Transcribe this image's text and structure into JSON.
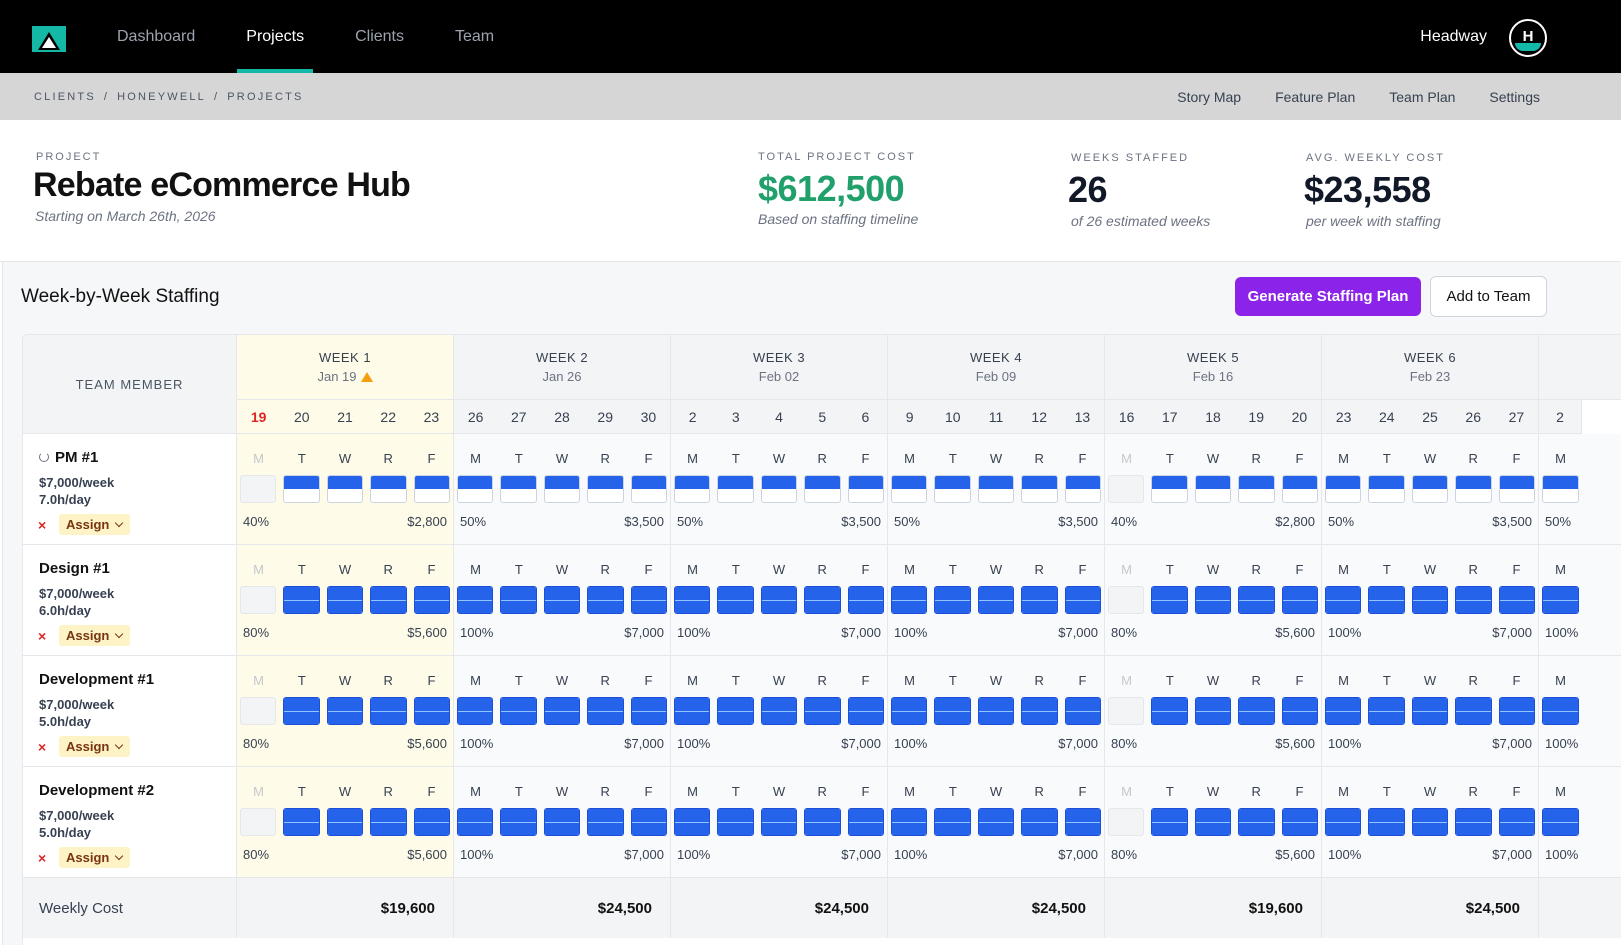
{
  "nav": {
    "tabs": [
      {
        "label": "Dashboard",
        "active": false
      },
      {
        "label": "Projects",
        "active": true
      },
      {
        "label": "Clients",
        "active": false
      },
      {
        "label": "Team",
        "active": false
      }
    ],
    "brand": "Headway",
    "avatar_letter": "H",
    "accent_color": "#14b8a6"
  },
  "breadcrumb": [
    "CLIENTS",
    "/",
    "HONEYWELL",
    "/",
    "PROJECTS"
  ],
  "sublinks": [
    "Story Map",
    "Feature Plan",
    "Team Plan",
    "Settings"
  ],
  "project": {
    "label": "PROJECT",
    "title": "Rebate eCommerce Hub",
    "start": "Starting on March 26th, 2026"
  },
  "stats": [
    {
      "label": "TOTAL PROJECT COST",
      "value": "$612,500",
      "note": "Based on staffing timeline",
      "color": "#22a06b"
    },
    {
      "label": "WEEKS STAFFED",
      "value": "26",
      "note": "of 26 estimated weeks",
      "color": "#111111"
    },
    {
      "label": "AVG. WEEKLY COST",
      "value": "$23,558",
      "note": "per week with staffing",
      "color": "#111111"
    }
  ],
  "staffing": {
    "title": "Week-by-Week Staffing",
    "generate_label": "Generate Staffing Plan",
    "add_label": "Add to Team",
    "member_header": "TEAM MEMBER",
    "weeks": [
      {
        "label": "WEEK 1",
        "date": "Jan 19",
        "warning": true,
        "current": true,
        "days": [
          "19",
          "20",
          "21",
          "22",
          "23"
        ],
        "today_index": 0
      },
      {
        "label": "WEEK 2",
        "date": "Jan 26",
        "warning": false,
        "current": false,
        "days": [
          "26",
          "27",
          "28",
          "29",
          "30"
        ]
      },
      {
        "label": "WEEK 3",
        "date": "Feb 02",
        "warning": false,
        "current": false,
        "days": [
          "2",
          "3",
          "4",
          "5",
          "6"
        ]
      },
      {
        "label": "WEEK 4",
        "date": "Feb 09",
        "warning": false,
        "current": false,
        "days": [
          "9",
          "10",
          "11",
          "12",
          "13"
        ]
      },
      {
        "label": "WEEK 5",
        "date": "Feb 16",
        "warning": false,
        "current": false,
        "days": [
          "16",
          "17",
          "18",
          "19",
          "20"
        ]
      },
      {
        "label": "WEEK 6",
        "date": "Feb 23",
        "warning": false,
        "current": false,
        "days": [
          "23",
          "24",
          "25",
          "26",
          "27"
        ]
      },
      {
        "label": "",
        "date": "",
        "warning": false,
        "current": false,
        "days": [
          "2"
        ],
        "partial": true
      }
    ],
    "day_letters": [
      "M",
      "T",
      "W",
      "R",
      "F"
    ],
    "members": [
      {
        "name": "PM #1",
        "sync": true,
        "rate": "$7,000/week",
        "hours": "7.0h/day",
        "assign_label": "Assign",
        "day_fill": 0.5,
        "weeks": [
          {
            "pct": "40%",
            "cost": "$2,800",
            "monday_off": true
          },
          {
            "pct": "50%",
            "cost": "$3,500",
            "monday_off": false
          },
          {
            "pct": "50%",
            "cost": "$3,500",
            "monday_off": false
          },
          {
            "pct": "50%",
            "cost": "$3,500",
            "monday_off": false
          },
          {
            "pct": "40%",
            "cost": "$2,800",
            "monday_off": true
          },
          {
            "pct": "50%",
            "cost": "$3,500",
            "monday_off": false
          },
          {
            "pct": "50%",
            "cost": "",
            "monday_off": false
          }
        ]
      },
      {
        "name": "Design #1",
        "sync": false,
        "rate": "$7,000/week",
        "hours": "6.0h/day",
        "assign_label": "Assign",
        "day_fill": 1,
        "weeks": [
          {
            "pct": "80%",
            "cost": "$5,600",
            "monday_off": true
          },
          {
            "pct": "100%",
            "cost": "$7,000",
            "monday_off": false
          },
          {
            "pct": "100%",
            "cost": "$7,000",
            "monday_off": false
          },
          {
            "pct": "100%",
            "cost": "$7,000",
            "monday_off": false
          },
          {
            "pct": "80%",
            "cost": "$5,600",
            "monday_off": true
          },
          {
            "pct": "100%",
            "cost": "$7,000",
            "monday_off": false
          },
          {
            "pct": "100%",
            "cost": "",
            "monday_off": false
          }
        ]
      },
      {
        "name": "Development #1",
        "sync": false,
        "rate": "$7,000/week",
        "hours": "5.0h/day",
        "assign_label": "Assign",
        "day_fill": 1,
        "weeks": [
          {
            "pct": "80%",
            "cost": "$5,600",
            "monday_off": true
          },
          {
            "pct": "100%",
            "cost": "$7,000",
            "monday_off": false
          },
          {
            "pct": "100%",
            "cost": "$7,000",
            "monday_off": false
          },
          {
            "pct": "100%",
            "cost": "$7,000",
            "monday_off": false
          },
          {
            "pct": "80%",
            "cost": "$5,600",
            "monday_off": true
          },
          {
            "pct": "100%",
            "cost": "$7,000",
            "monday_off": false
          },
          {
            "pct": "100%",
            "cost": "",
            "monday_off": false
          }
        ]
      },
      {
        "name": "Development #2",
        "sync": false,
        "rate": "$7,000/week",
        "hours": "5.0h/day",
        "assign_label": "Assign",
        "day_fill": 1,
        "weeks": [
          {
            "pct": "80%",
            "cost": "$5,600",
            "monday_off": true
          },
          {
            "pct": "100%",
            "cost": "$7,000",
            "monday_off": false
          },
          {
            "pct": "100%",
            "cost": "$7,000",
            "monday_off": false
          },
          {
            "pct": "100%",
            "cost": "$7,000",
            "monday_off": false
          },
          {
            "pct": "80%",
            "cost": "$5,600",
            "monday_off": true
          },
          {
            "pct": "100%",
            "cost": "$7,000",
            "monday_off": false
          },
          {
            "pct": "100%",
            "cost": "",
            "monday_off": false
          }
        ]
      }
    ],
    "footer_label": "Weekly Cost",
    "weekly_costs": [
      "$19,600",
      "$24,500",
      "$24,500",
      "$24,500",
      "$19,600",
      "$24,500",
      ""
    ]
  }
}
